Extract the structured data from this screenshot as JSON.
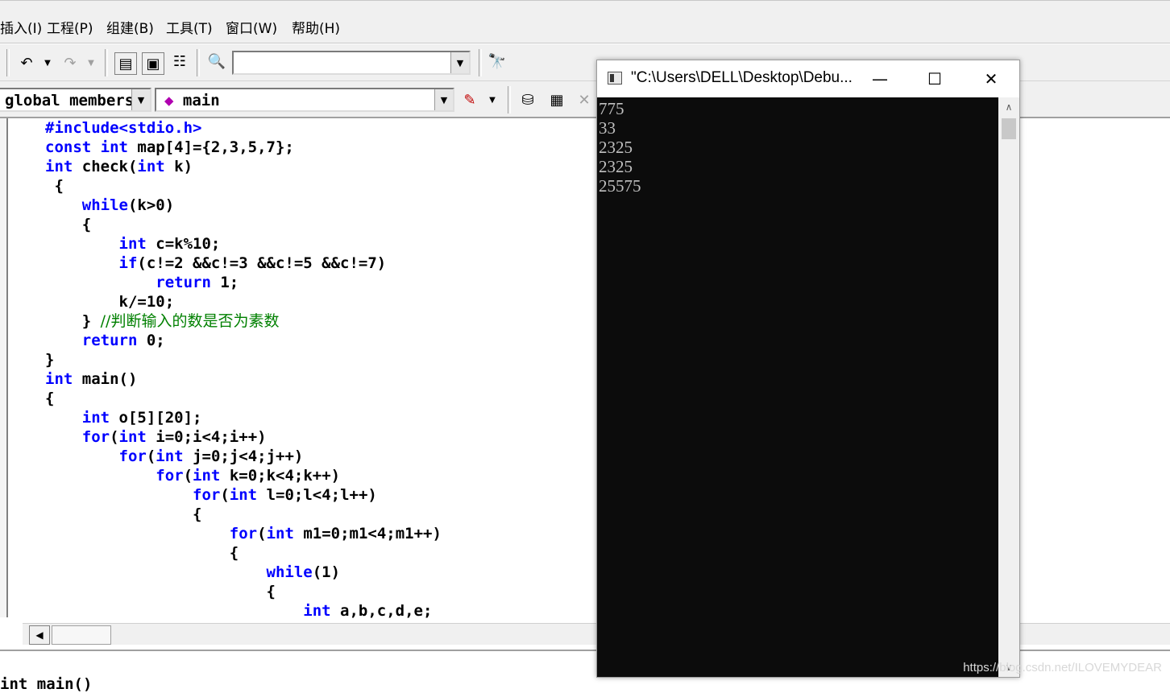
{
  "menu": [
    "插入(I)",
    "工程(P)",
    "组建(B)",
    "工具(T)",
    "窗口(W)",
    "帮助(H)"
  ],
  "toolbar": {
    "find_combo_value": ""
  },
  "wizard": {
    "class_combo": "global members",
    "function_combo": "main"
  },
  "code_lines": [
    [
      {
        "t": "#include<stdio.h>",
        "c": "kw"
      }
    ],
    [
      {
        "t": "const int",
        "c": "kw"
      },
      {
        "t": " map[4]={2,3,5,7};",
        "c": ""
      }
    ],
    [
      {
        "t": "int",
        "c": "kw"
      },
      {
        "t": " check(",
        "c": ""
      },
      {
        "t": "int",
        "c": "kw"
      },
      {
        "t": " k)",
        "c": ""
      }
    ],
    [
      {
        "t": " {",
        "c": ""
      }
    ],
    [
      {
        "t": "    while",
        "c": "kw"
      },
      {
        "t": "(k>0)",
        "c": ""
      }
    ],
    [
      {
        "t": "    {",
        "c": ""
      }
    ],
    [
      {
        "t": "        int",
        "c": "kw"
      },
      {
        "t": " c=k%10;",
        "c": ""
      }
    ],
    [
      {
        "t": "        if",
        "c": "kw"
      },
      {
        "t": "(c!=2 &&c!=3 &&c!=5 &&c!=7)",
        "c": ""
      }
    ],
    [
      {
        "t": "            return",
        "c": "kw"
      },
      {
        "t": " 1;",
        "c": ""
      }
    ],
    [
      {
        "t": "        k/=10;",
        "c": ""
      }
    ],
    [
      {
        "t": "    } ",
        "c": ""
      },
      {
        "t": "//判断输入的数是否为素数",
        "c": "cm"
      }
    ],
    [
      {
        "t": "    return",
        "c": "kw"
      },
      {
        "t": " 0;",
        "c": ""
      }
    ],
    [
      {
        "t": "}",
        "c": ""
      }
    ],
    [
      {
        "t": "int",
        "c": "kw"
      },
      {
        "t": " main()",
        "c": ""
      }
    ],
    [
      {
        "t": "{",
        "c": ""
      }
    ],
    [
      {
        "t": "    int",
        "c": "kw"
      },
      {
        "t": " o[5][20];",
        "c": ""
      }
    ],
    [
      {
        "t": "    for",
        "c": "kw"
      },
      {
        "t": "(",
        "c": ""
      },
      {
        "t": "int",
        "c": "kw"
      },
      {
        "t": " i=0;i<4;i++)",
        "c": ""
      }
    ],
    [
      {
        "t": "        for",
        "c": "kw"
      },
      {
        "t": "(",
        "c": ""
      },
      {
        "t": "int",
        "c": "kw"
      },
      {
        "t": " j=0;j<4;j++)",
        "c": ""
      }
    ],
    [
      {
        "t": "            for",
        "c": "kw"
      },
      {
        "t": "(",
        "c": ""
      },
      {
        "t": "int",
        "c": "kw"
      },
      {
        "t": " k=0;k<4;k++)",
        "c": ""
      }
    ],
    [
      {
        "t": "                for",
        "c": "kw"
      },
      {
        "t": "(",
        "c": ""
      },
      {
        "t": "int",
        "c": "kw"
      },
      {
        "t": " l=0;l<4;l++)",
        "c": ""
      }
    ],
    [
      {
        "t": "                {",
        "c": ""
      }
    ],
    [
      {
        "t": "                    for",
        "c": "kw"
      },
      {
        "t": "(",
        "c": ""
      },
      {
        "t": "int",
        "c": "kw"
      },
      {
        "t": " m1=0;m1<4;m1++)",
        "c": ""
      }
    ],
    [
      {
        "t": "                    {",
        "c": ""
      }
    ],
    [
      {
        "t": "                        while",
        "c": "kw"
      },
      {
        "t": "(1)",
        "c": ""
      }
    ],
    [
      {
        "t": "                        {",
        "c": ""
      }
    ],
    [
      {
        "t": "                            int",
        "c": "kw"
      },
      {
        "t": " a,b,c,d,e;",
        "c": ""
      }
    ]
  ],
  "bottom_partial_text": "int main()",
  "console": {
    "title": "\"C:\\Users\\DELL\\Desktop\\Debu...",
    "output": [
      "775",
      "33",
      "2325",
      "2325",
      "25575"
    ]
  },
  "watermark": "https://blog.csdn.net/ILOVEMYDEAR"
}
